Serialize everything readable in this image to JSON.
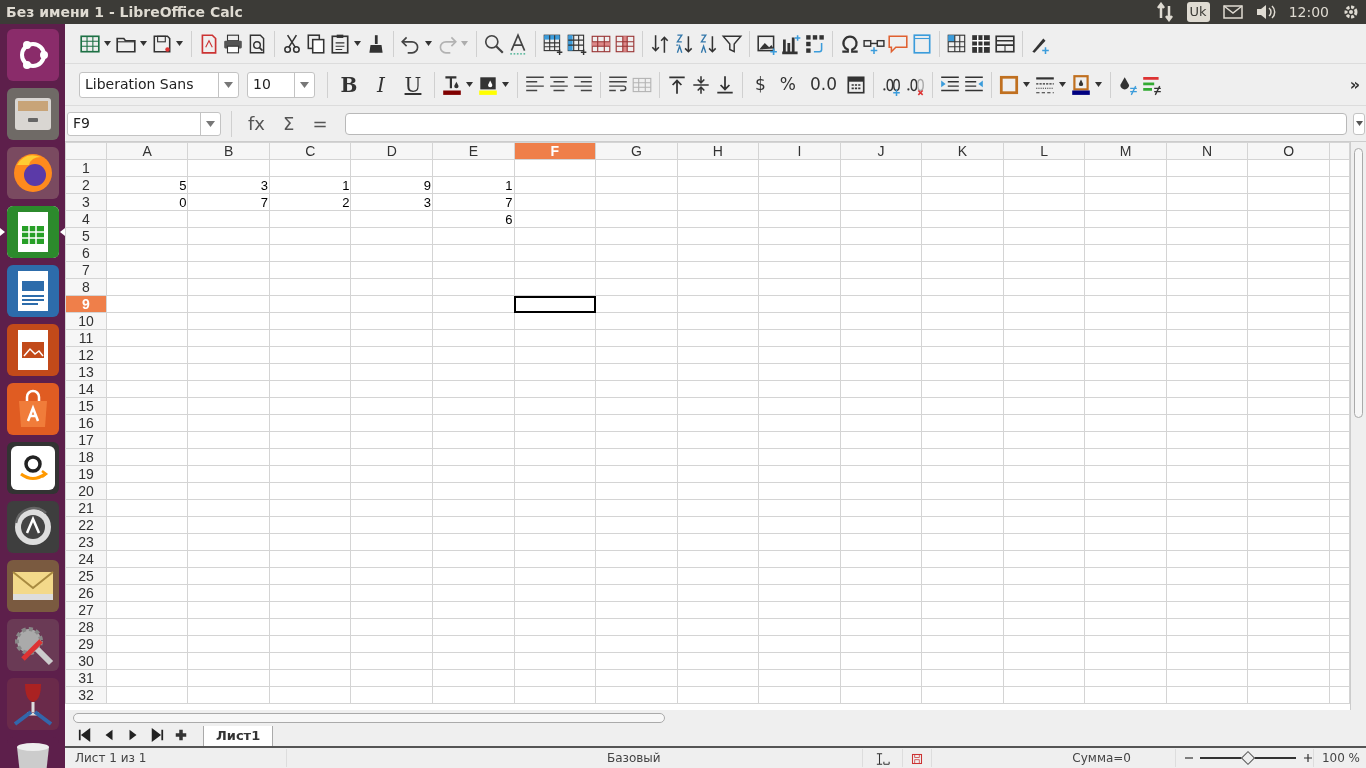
{
  "top_bar": {
    "title": "Без имени 1 - LibreOffice Calc",
    "keyboard": "Uk",
    "clock": "12:00"
  },
  "launcher": [
    {
      "active": false
    },
    {
      "active": false
    },
    {
      "active": false
    },
    {
      "active": true
    },
    {
      "active": false
    },
    {
      "active": false
    },
    {
      "active": false
    },
    {
      "active": false
    },
    {
      "active": false
    },
    {
      "active": false
    },
    {
      "active": false
    },
    {
      "active": false
    },
    {
      "active": false
    }
  ],
  "toolbar_standard": [
    {
      "kind": "button",
      "menu": true,
      "disabled": false
    },
    {
      "kind": "button",
      "menu": true,
      "disabled": false
    },
    {
      "kind": "button",
      "menu": true,
      "disabled": false
    },
    {
      "kind": "separator"
    },
    {
      "kind": "button",
      "menu": false,
      "disabled": false
    },
    {
      "kind": "button",
      "menu": false,
      "disabled": false
    },
    {
      "kind": "button",
      "menu": false,
      "disabled": false
    },
    {
      "kind": "separator"
    },
    {
      "kind": "button",
      "menu": false,
      "disabled": false
    },
    {
      "kind": "button",
      "menu": false,
      "disabled": false
    },
    {
      "kind": "button",
      "menu": true,
      "disabled": false
    },
    {
      "kind": "button",
      "menu": false,
      "disabled": false
    },
    {
      "kind": "separator"
    },
    {
      "kind": "button",
      "menu": true,
      "disabled": false
    },
    {
      "kind": "button",
      "menu": true,
      "disabled": true
    },
    {
      "kind": "separator"
    },
    {
      "kind": "button",
      "menu": false,
      "disabled": false
    },
    {
      "kind": "button",
      "menu": false,
      "disabled": false
    },
    {
      "kind": "separator"
    },
    {
      "kind": "button",
      "menu": false,
      "disabled": false
    },
    {
      "kind": "button",
      "menu": false,
      "disabled": false
    },
    {
      "kind": "button",
      "menu": false,
      "disabled": false
    },
    {
      "kind": "button",
      "menu": false,
      "disabled": false
    },
    {
      "kind": "separator"
    },
    {
      "kind": "button",
      "menu": false,
      "disabled": false
    },
    {
      "kind": "button",
      "menu": false,
      "disabled": false
    },
    {
      "kind": "button",
      "menu": false,
      "disabled": false
    },
    {
      "kind": "button",
      "menu": false,
      "disabled": false
    },
    {
      "kind": "separator"
    },
    {
      "kind": "button",
      "menu": false,
      "disabled": false
    },
    {
      "kind": "button",
      "menu": false,
      "disabled": false
    },
    {
      "kind": "button",
      "menu": false,
      "disabled": false
    },
    {
      "kind": "separator"
    },
    {
      "kind": "button",
      "menu": false,
      "disabled": false
    },
    {
      "kind": "button",
      "menu": false,
      "disabled": false
    },
    {
      "kind": "button",
      "menu": false,
      "disabled": false
    },
    {
      "kind": "button",
      "menu": false,
      "disabled": false
    },
    {
      "kind": "separator"
    },
    {
      "kind": "button",
      "menu": false,
      "disabled": false
    },
    {
      "kind": "button",
      "menu": false,
      "disabled": false
    },
    {
      "kind": "button",
      "menu": false,
      "disabled": false
    },
    {
      "kind": "separator"
    },
    {
      "kind": "button",
      "menu": false,
      "disabled": false
    }
  ],
  "toolbar_formatting": [
    {
      "kind": "font",
      "value": "Liberation Sans"
    },
    {
      "kind": "size",
      "value": "10"
    },
    {
      "kind": "separator"
    },
    {
      "kind": "bold",
      "label": "B"
    },
    {
      "kind": "italic",
      "label": "I"
    },
    {
      "kind": "underline",
      "label": "U"
    },
    {
      "kind": "separator"
    },
    {
      "kind": "button",
      "menu": true,
      "disabled": false
    },
    {
      "kind": "button",
      "menu": true,
      "disabled": false
    },
    {
      "kind": "separator"
    },
    {
      "kind": "button",
      "menu": false,
      "disabled": false
    },
    {
      "kind": "button",
      "menu": false,
      "disabled": false
    },
    {
      "kind": "button",
      "menu": false,
      "disabled": false
    },
    {
      "kind": "separator"
    },
    {
      "kind": "button",
      "menu": false,
      "disabled": false
    },
    {
      "kind": "button",
      "menu": false,
      "disabled": true
    },
    {
      "kind": "separator"
    },
    {
      "kind": "button",
      "menu": false,
      "disabled": false
    },
    {
      "kind": "button",
      "menu": false,
      "disabled": false
    },
    {
      "kind": "button",
      "menu": false,
      "disabled": false
    },
    {
      "kind": "separator"
    },
    {
      "kind": "symbol",
      "label": "$"
    },
    {
      "kind": "symbol",
      "label": "%"
    },
    {
      "kind": "symbol",
      "label": "0.0"
    },
    {
      "kind": "button",
      "menu": false,
      "disabled": false
    },
    {
      "kind": "separator"
    },
    {
      "kind": "button",
      "menu": false,
      "disabled": false
    },
    {
      "kind": "button",
      "menu": false,
      "disabled": false
    },
    {
      "kind": "separator"
    },
    {
      "kind": "button",
      "menu": false,
      "disabled": false
    },
    {
      "kind": "button",
      "menu": false,
      "disabled": false
    },
    {
      "kind": "separator"
    },
    {
      "kind": "button",
      "menu": true,
      "disabled": false
    },
    {
      "kind": "button",
      "menu": true,
      "disabled": false
    },
    {
      "kind": "button",
      "menu": true,
      "disabled": false
    },
    {
      "kind": "separator"
    },
    {
      "kind": "button",
      "menu": false,
      "disabled": false
    },
    {
      "kind": "button",
      "menu": false,
      "disabled": false
    },
    {
      "kind": "more",
      "label": "»"
    }
  ],
  "formula_bar": {
    "name_box": "F9",
    "function_wizard": "fx",
    "sum": "Σ",
    "equals": "="
  },
  "sheet": {
    "columns": [
      {
        "label": "A",
        "selected": false
      },
      {
        "label": "B",
        "selected": false
      },
      {
        "label": "C",
        "selected": false
      },
      {
        "label": "D",
        "selected": false
      },
      {
        "label": "E",
        "selected": false
      },
      {
        "label": "F",
        "selected": true
      },
      {
        "label": "G",
        "selected": false
      },
      {
        "label": "H",
        "selected": false
      },
      {
        "label": "I",
        "selected": false
      },
      {
        "label": "J",
        "selected": false
      },
      {
        "label": "K",
        "selected": false
      },
      {
        "label": "L",
        "selected": false
      },
      {
        "label": "M",
        "selected": false
      },
      {
        "label": "N",
        "selected": false
      },
      {
        "label": "O",
        "selected": false
      }
    ],
    "rows": [
      {
        "label": "1",
        "selected": false,
        "values": []
      },
      {
        "label": "2",
        "selected": false,
        "values": [
          {
            "kind": "number",
            "value": "5"
          },
          {
            "kind": "number",
            "value": "3"
          },
          {
            "kind": "number",
            "value": "1"
          },
          {
            "kind": "number",
            "value": "9"
          },
          {
            "kind": "number",
            "value": "1"
          }
        ]
      },
      {
        "label": "3",
        "selected": false,
        "values": [
          {
            "kind": "number",
            "value": "0"
          },
          {
            "kind": "number",
            "value": "7"
          },
          {
            "kind": "number",
            "value": "2"
          },
          {
            "kind": "number",
            "value": "3"
          },
          {
            "kind": "number",
            "value": "7"
          }
        ]
      },
      {
        "label": "4",
        "selected": false,
        "values": [
          {
            "kind": "blank"
          },
          {
            "kind": "blank"
          },
          {
            "kind": "blank"
          },
          {
            "kind": "blank"
          },
          {
            "kind": "number",
            "value": "6"
          }
        ]
      },
      {
        "label": "5",
        "selected": false,
        "values": []
      },
      {
        "label": "6",
        "selected": false,
        "values": []
      },
      {
        "label": "7",
        "selected": false,
        "values": []
      },
      {
        "label": "8",
        "selected": false,
        "values": []
      },
      {
        "label": "9",
        "selected": true,
        "values": []
      },
      {
        "label": "10",
        "selected": false,
        "values": []
      },
      {
        "label": "11",
        "selected": false,
        "values": []
      },
      {
        "label": "12",
        "selected": false,
        "values": []
      },
      {
        "label": "13",
        "selected": false,
        "values": []
      },
      {
        "label": "14",
        "selected": false,
        "values": []
      },
      {
        "label": "15",
        "selected": false,
        "values": []
      },
      {
        "label": "16",
        "selected": false,
        "values": []
      },
      {
        "label": "17",
        "selected": false,
        "values": []
      },
      {
        "label": "18",
        "selected": false,
        "values": []
      },
      {
        "label": "19",
        "selected": false,
        "values": []
      },
      {
        "label": "20",
        "selected": false,
        "values": []
      },
      {
        "label": "21",
        "selected": false,
        "values": []
      },
      {
        "label": "22",
        "selected": false,
        "values": []
      },
      {
        "label": "23",
        "selected": false,
        "values": []
      },
      {
        "label": "24",
        "selected": false,
        "values": []
      },
      {
        "label": "25",
        "selected": false,
        "values": []
      },
      {
        "label": "26",
        "selected": false,
        "values": []
      },
      {
        "label": "27",
        "selected": false,
        "values": []
      },
      {
        "label": "28",
        "selected": false,
        "values": []
      },
      {
        "label": "29",
        "selected": false,
        "values": []
      },
      {
        "label": "30",
        "selected": false,
        "values": []
      },
      {
        "label": "31",
        "selected": false,
        "values": []
      },
      {
        "label": "32",
        "selected": false,
        "values": []
      }
    ]
  },
  "sheet_tabs": [
    {
      "label": "Лист1",
      "selected": true
    }
  ],
  "status_bar": {
    "sheet_info": "Лист 1 из 1",
    "page_style": "Базовый",
    "sum": "Сумма=0",
    "zoom": {
      "level": 0.5,
      "reading": "100 %"
    }
  }
}
